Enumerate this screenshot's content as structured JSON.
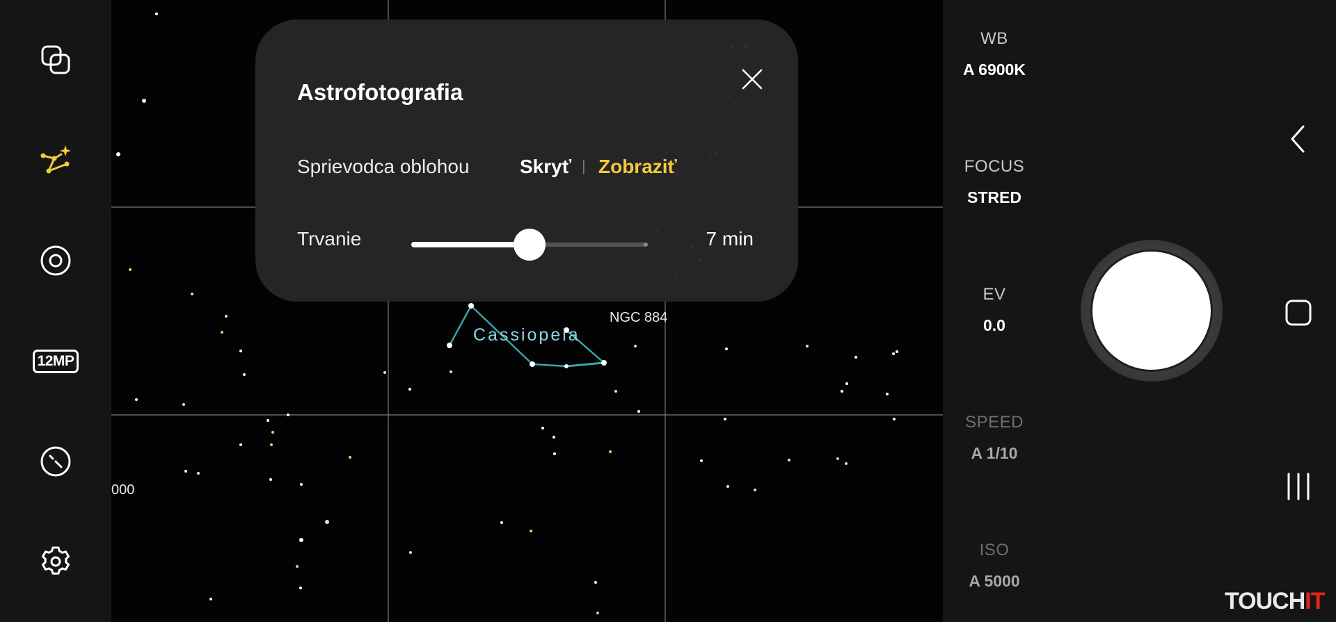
{
  "dialog": {
    "title": "Astrofotografia",
    "sky_guide_label": "Sprievodca oblohou",
    "sky_guide_options": {
      "hide": "Skryť",
      "show": "Zobraziť",
      "selected": "show"
    },
    "duration_label": "Trvanie",
    "duration_value": "7 min",
    "duration_slider_fraction": 0.5
  },
  "left_toolbar": {
    "items": [
      {
        "name": "filters-icon"
      },
      {
        "name": "astro-mode-icon",
        "active": true
      },
      {
        "name": "lens-icon"
      },
      {
        "name": "resolution-badge",
        "label": "12MP"
      },
      {
        "name": "timer-icon"
      },
      {
        "name": "settings-icon"
      }
    ]
  },
  "sky_map": {
    "constellation": "Cassiopeia",
    "object_label": "NGC 884",
    "edge_label": "000"
  },
  "settings": {
    "wb": {
      "label": "WB",
      "value": "A 6900K"
    },
    "focus": {
      "label": "FOCUS",
      "value": "STRED"
    },
    "ev": {
      "label": "EV",
      "value": "0.0"
    },
    "speed": {
      "label": "SPEED",
      "value": "A 1/10"
    },
    "iso": {
      "label": "ISO",
      "value": "A 5000"
    }
  },
  "nav": {
    "back": "chevron-left-icon",
    "home": "home-square-icon",
    "recents": "recents-icon"
  },
  "watermark": {
    "main": "TOUCH",
    "accent": "IT"
  },
  "colors": {
    "accent_yellow": "#f4c93b",
    "constellation_line": "#3aa7a8",
    "constellation_text": "#8fd3e8",
    "panel_bg": "#151515",
    "dialog_bg": "#262626",
    "watermark_accent": "#e2261c"
  }
}
